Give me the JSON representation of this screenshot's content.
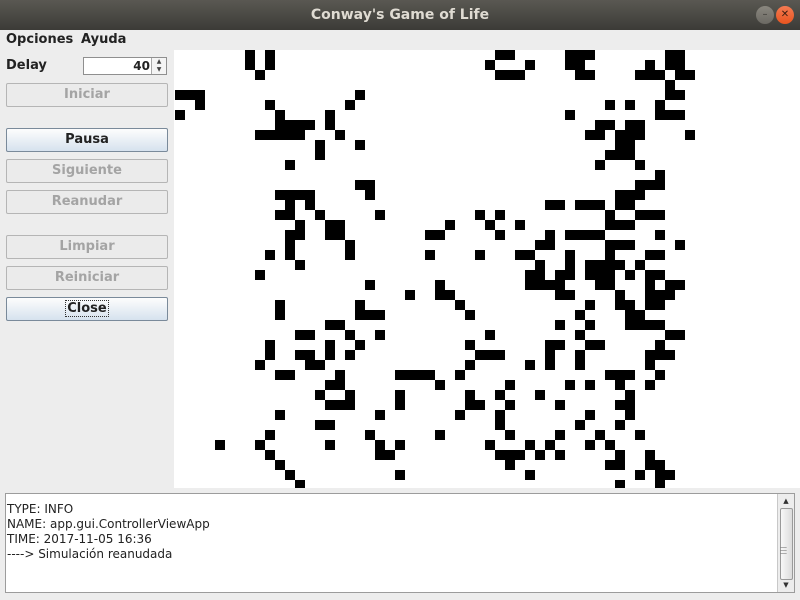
{
  "window": {
    "title": "Conway's Game of Life",
    "minimize_icon": "minimize-icon",
    "close_icon": "close-icon"
  },
  "menu": [
    "Opciones",
    "Ayuda"
  ],
  "controls": {
    "delay_label": "Delay",
    "delay_value": "40",
    "buttons": [
      {
        "id": "start",
        "label": "Iniciar",
        "enabled": false
      },
      {
        "id": "pause",
        "label": "Pausa",
        "enabled": true
      },
      {
        "id": "next",
        "label": "Siguiente",
        "enabled": false
      },
      {
        "id": "resume",
        "label": "Reanudar",
        "enabled": false
      },
      {
        "id": "clear",
        "label": "Limpiar",
        "enabled": false
      },
      {
        "id": "restart",
        "label": "Reiniciar",
        "enabled": false
      },
      {
        "id": "close",
        "label": "Close",
        "enabled": true
      }
    ]
  },
  "board": {
    "cell_color": "#000000",
    "background": "#ffffff",
    "rows": [
      ".......#.#......................##.....###.......##.",
      ".......#.#.....................#...#...##......#.##.",
      "........#.......................###.....##....###.##",
      ".................................................#..",
      "###...............#..............................##.",
      "..#......#.......#.........................#.#..#...",
      "#.........#....#.......................#........###.",
      "..........####.#..........................##.##.....",
      "........#####...#........................##.###....#",
      "..............#...#.........................##......",
      "..............#............................###......",
      "...........#..............................#...#.....",
      "................................................#...",
      "..................##..........................###...",
      "..........####.....#........................###.....",
      "...........#.#.......................##.###.##......",
      "..........##..#.....#.........#.#..........#..###...",
      "............#..##..........#...#..#........###......",
      "...........##..##........##.....#....#.####.....#...",
      "...........#.....#..................##.....###....#.",
      ".........#.#.....#.......#....#...##...#...#...##...",
      "............#.......................#..#.####.#.....",
      "........#..........................##.##.###.#.##...",
      "...................#......#........####...##...#.##.",
      ".......................#..##..........##....#..###..",
      "..........#.......#.........#............#..##.##...",
      "..........#.......###........#..........#....##.....",
      "...............##.....................#..#...####...",
      "............##...#..#..........#........#........##.",
      ".........#.....#..#..........#.......##..##.....#...",
      ".........#..##.#.#............###....#..#......###..",
      "........#....##..............#.....#.#..#......#....",
      "..........##....#.....####..#..............###..#...",
      "...............##.........#......#.....#.#..#..#....",
      "..............#..#....#......#..#...#........#......",
      "...............###....#......##..#....#.....##......",
      "..........#.........#.......#...#........#...#......",
      "..............##................#.......#...#.......",
      ".........#.........#......#......#....#...#...#.....",
      "....#...#......#....#.#........#...#.#...#.#........",
      ".........#..........##..........###.#.#.....#..#....",
      "..........#......................#.........##..##...",
      "...........#..........#............#..........#.##..",
      "............#...............................#...#...",
      "................#............###.........##..##.....",
      "...............#.......#...#.#......#.....#........#",
      ".......#.......#...........#....#..............#..#.",
      "........##......#.........###.................#.#...",
      "..........#.......##.........#..........##.........#",
      "............#.....##.....#............#.......#..#..",
      "..........#.........#......#......#.#......#...#..##",
      "...........................#.........#.....#.....#.."
    ]
  },
  "log": {
    "lines": [
      "TYPE: INFO",
      "NAME: app.gui.ControllerViewApp",
      "TIME: 2017-11-05 16:36",
      "----> Simulación reanudada"
    ]
  }
}
